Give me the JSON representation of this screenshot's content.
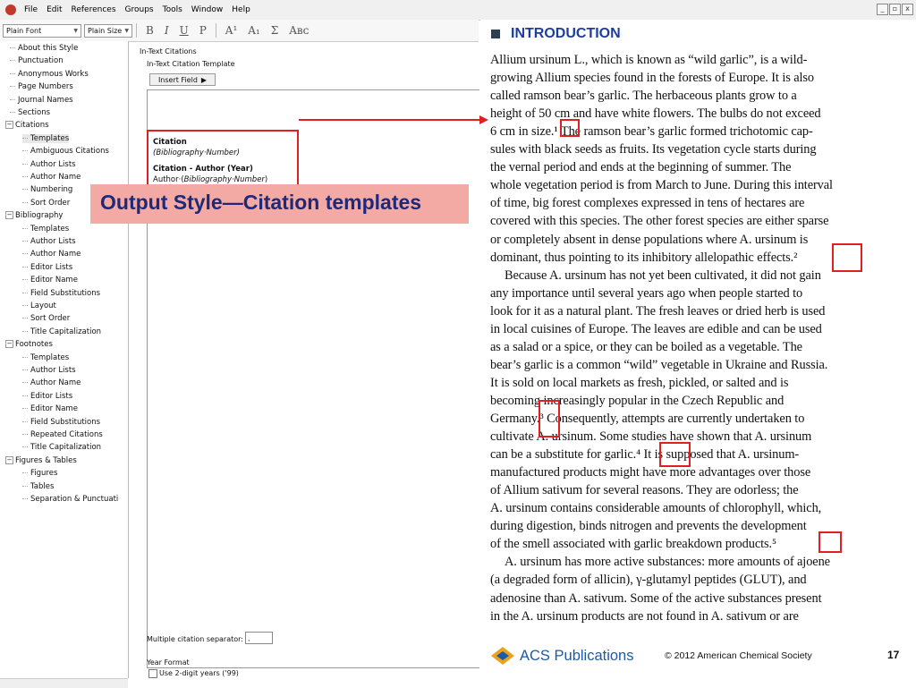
{
  "menu": [
    "File",
    "Edit",
    "References",
    "Groups",
    "Tools",
    "Window",
    "Help"
  ],
  "window_controls": [
    "_",
    "▫",
    "x"
  ],
  "toolbar": {
    "font_value": "Plain Font",
    "size_value": "Plain Size",
    "bold": "B",
    "italic": "I",
    "underline": "U",
    "plain": "P",
    "superscript": "A¹",
    "subscript": "A₁",
    "sigma": "Σ",
    "smallcaps": "Aʙᴄ"
  },
  "tree": [
    {
      "label": "About this Style",
      "level": 1
    },
    {
      "label": "Punctuation",
      "level": 1
    },
    {
      "label": "Anonymous Works",
      "level": 1
    },
    {
      "label": "Page Numbers",
      "level": 1
    },
    {
      "label": "Journal Names",
      "level": 1
    },
    {
      "label": "Sections",
      "level": 1
    },
    {
      "label": "Citations",
      "level": 0,
      "expanded": true
    },
    {
      "label": "Templates",
      "level": 2,
      "selected": true
    },
    {
      "label": "Ambiguous Citations",
      "level": 2
    },
    {
      "label": "Author Lists",
      "level": 2
    },
    {
      "label": "Author Name",
      "level": 2
    },
    {
      "label": "Numbering",
      "level": 2
    },
    {
      "label": "Sort Order",
      "level": 2
    },
    {
      "label": "Bibliography",
      "level": 0,
      "expanded": true
    },
    {
      "label": "Templates",
      "level": 2
    },
    {
      "label": "Author Lists",
      "level": 2
    },
    {
      "label": "Author Name",
      "level": 2
    },
    {
      "label": "Editor Lists",
      "level": 2
    },
    {
      "label": "Editor Name",
      "level": 2
    },
    {
      "label": "Field Substitutions",
      "level": 2
    },
    {
      "label": "Layout",
      "level": 2
    },
    {
      "label": "Sort Order",
      "level": 2
    },
    {
      "label": "Title Capitalization",
      "level": 2
    },
    {
      "label": "Footnotes",
      "level": 0,
      "expanded": true
    },
    {
      "label": "Templates",
      "level": 2
    },
    {
      "label": "Author Lists",
      "level": 2
    },
    {
      "label": "Author Name",
      "level": 2
    },
    {
      "label": "Editor Lists",
      "level": 2
    },
    {
      "label": "Editor Name",
      "level": 2
    },
    {
      "label": "Field Substitutions",
      "level": 2
    },
    {
      "label": "Repeated Citations",
      "level": 2
    },
    {
      "label": "Title Capitalization",
      "level": 2
    },
    {
      "label": "Figures & Tables",
      "level": 0,
      "expanded": true
    },
    {
      "label": "Figures",
      "level": 2
    },
    {
      "label": "Tables",
      "level": 2
    },
    {
      "label": "Separation & Punctuati",
      "level": 2
    }
  ],
  "panel": {
    "heading": "In-Text Citations",
    "group_label": "In-Text Citation Template",
    "insert_field": "Insert Field",
    "template": {
      "citation_label": "Citation",
      "citation_value": "(Bibliography·Number)",
      "author_year_label": "Citation - Author (Year)",
      "author_year_prefix": "Author·(",
      "author_year_value": "Bibliography·Number",
      "author_year_suffix": ")"
    },
    "separator_label": "Multiple citation separator:",
    "separator_value": ",",
    "year_format_label": "Year Format",
    "two_digit_label": "Use 2-digit years ('99)"
  },
  "overlay_text": "Output Style—Citation templates",
  "article": {
    "section_title": "INTRODUCTION",
    "lines": [
      "Allium ursinum L., which is known as “wild garlic”, is a wild-",
      "growing Allium species found in the forests of Europe. It is also",
      "called ramson bear’s garlic. The herbaceous plants grow to a",
      "height of 50 cm and have white flowers. The bulbs do not exceed",
      "6 cm in size.¹ The ramson bear’s garlic formed trichotomic cap-",
      "sules with black seeds as fruits. Its vegetation cycle starts during",
      "the vernal period and ends at the beginning of summer. The",
      "whole vegetation period is from March to June. During this interval",
      "of time, big forest complexes expressed in tens of hectares are",
      "covered with this species. The other forest species are either sparse",
      "or completely absent in dense populations where A. ursinum is",
      "dominant, thus pointing to its inhibitory allelopathic effects.²",
      "Because A. ursinum has not yet been cultivated, it did not gain",
      "any importance until several years ago when people started to",
      "look for it as a natural plant. The fresh leaves or dried herb is used",
      "in local cuisines of Europe. The leaves are edible and can be used",
      "as a salad or a spice, or they can be boiled as a vegetable. The",
      "bear’s garlic is a common “wild” vegetable in Ukraine and Russia.",
      "It is sold on local markets as fresh, pickled, or salted and is",
      "becoming increasingly popular in the Czech Republic and",
      "Germany.³ Consequently, attempts are currently undertaken to",
      "cultivate A. ursinum. Some studies have shown that A. ursinum",
      "can be a substitute for garlic.⁴ It is supposed that A. ursinum-",
      "manufactured products might have more advantages over those",
      "of Allium sativum for several reasons. They are odorless; the",
      "A. ursinum contains considerable amounts of chlorophyll, which,",
      "during digestion, binds nitrogen and prevents the development",
      "of the smell associated with garlic breakdown products.⁵",
      "A. ursinum has more active substances: more amounts of ajoene",
      "(a degraded form of allicin), γ-glutamyl peptides (GLUT), and",
      "adenosine than A. sativum. Some of the active substances present",
      "in the A. ursinum products are not found in A. sativum or are"
    ],
    "publisher": "ACS Publications",
    "copyright": "© 2012 American Chemical Society",
    "page_number": "17"
  },
  "colors": {
    "accent_red": "#e02020",
    "overlay_bg": "#f3a9a4",
    "overlay_text": "#1e2a78",
    "heading_blue": "#1c3f9e"
  }
}
